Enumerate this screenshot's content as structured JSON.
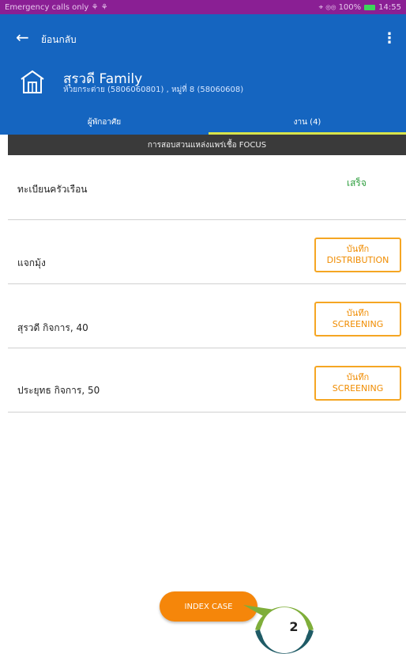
{
  "status_bar": {
    "left": "Emergency calls only ⚘ ⚘",
    "right": "⌖ ⦾⦾ 100%",
    "time": "14:55"
  },
  "header": {
    "back_label": "ย้อนกลับ",
    "family_name": "สุรวดี Family",
    "subtitle": "ห้วยกระต่าย (5806060801)  ,  หมู่ที่ 8 (58060608)",
    "tabs": [
      {
        "label": "ผู้พักอาศัย"
      },
      {
        "label": "งาน (4)"
      }
    ]
  },
  "section_title": "การสอบสวนแหล่งแพร่เชื้อ FOCUS",
  "rows": [
    {
      "label": "ทะเบียนครัวเรือน",
      "status": "เสร็จ"
    },
    {
      "label": "แจกมุ้ง",
      "button_line1": "บันทึก",
      "button_line2": "DISTRIBUTION"
    },
    {
      "label": "สุรวดี  กิจการ, 40",
      "button_line1": "บันทึก",
      "button_line2": "SCREENING"
    },
    {
      "label": "ประยุทธ  กิจการ, 50",
      "button_line1": "บันทึก",
      "button_line2": "SCREENING"
    }
  ],
  "index_case_label": "INDEX CASE",
  "step_badge": "2",
  "colors": {
    "header": "#1565c0",
    "accent": "#f5860a",
    "done": "#2e9e3e",
    "badge_ring": "#1f5b66",
    "badge_pointer": "#7fae3a"
  }
}
